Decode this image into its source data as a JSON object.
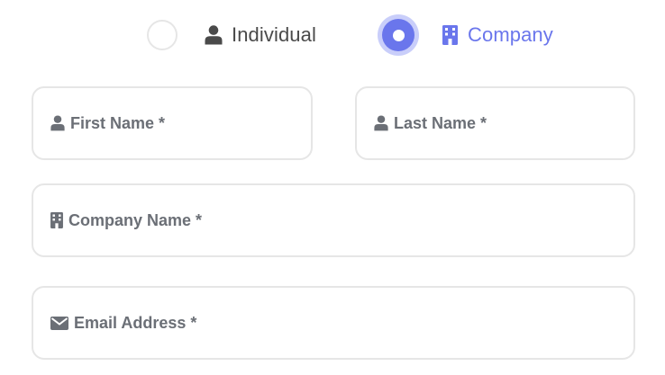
{
  "account_type": {
    "selected": "company",
    "options": [
      {
        "id": "individual",
        "label": "Individual",
        "icon": "user-icon",
        "checked": false
      },
      {
        "id": "company",
        "label": "Company",
        "icon": "building-icon",
        "checked": true
      }
    ]
  },
  "form": {
    "first_name": {
      "label": "First Name *",
      "icon": "user-icon",
      "value": ""
    },
    "last_name": {
      "label": "Last Name *",
      "icon": "user-icon",
      "value": ""
    },
    "company_name": {
      "label": "Company Name *",
      "icon": "building-icon",
      "value": ""
    },
    "email": {
      "label": "Email Address *",
      "icon": "envelope-icon",
      "value": ""
    }
  },
  "colors": {
    "accent": "#6a76ec",
    "accent_halo": "#c9cefa",
    "label_gray": "#6b6f76",
    "text_dark": "#4a4a4a",
    "border": "#e6e6e6"
  }
}
